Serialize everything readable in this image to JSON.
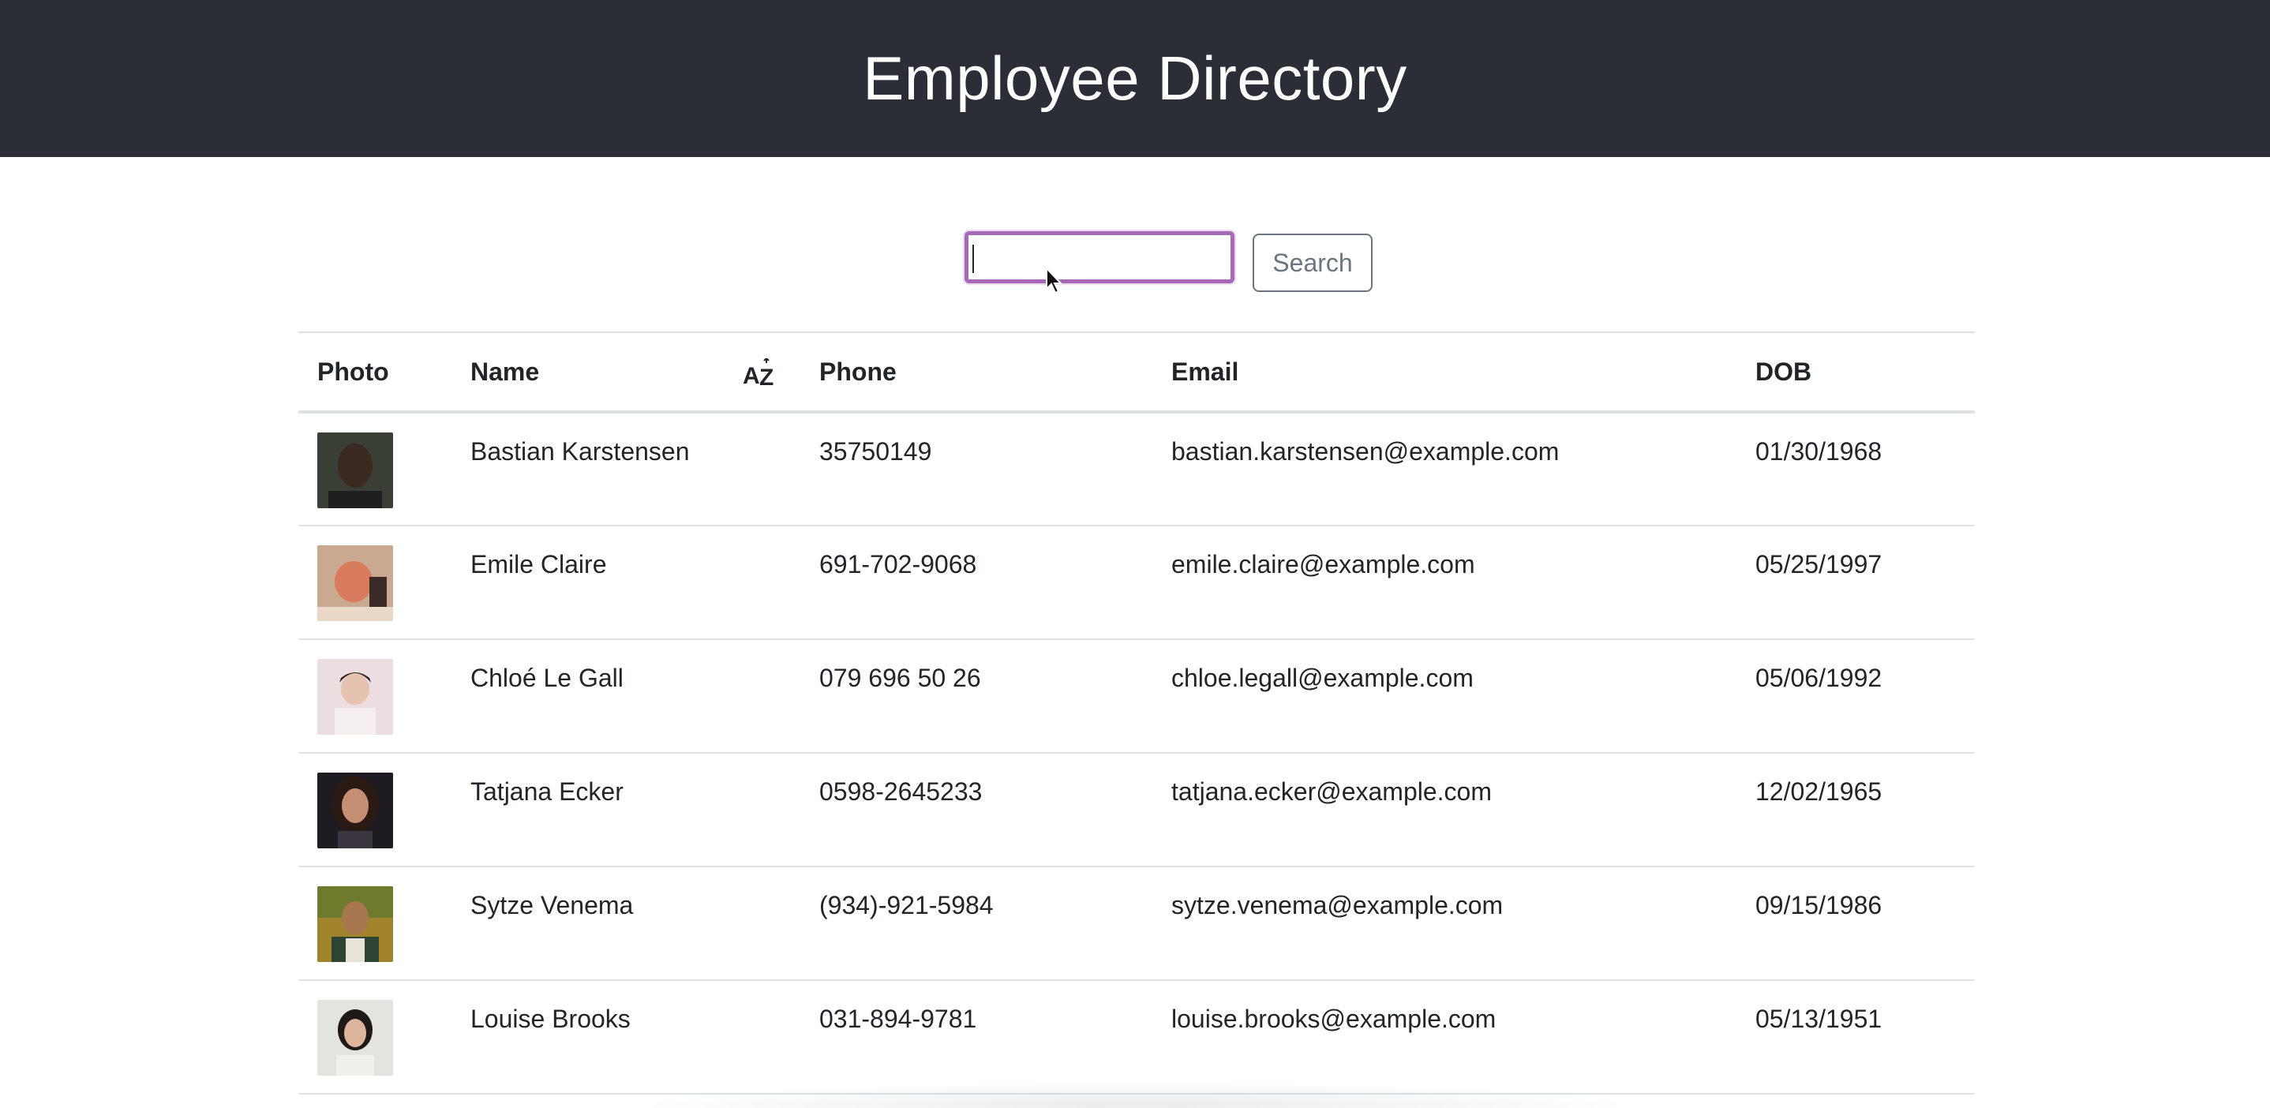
{
  "header": {
    "title": "Employee Directory"
  },
  "search": {
    "value": "",
    "button_label": "Search"
  },
  "table": {
    "columns": [
      "Photo",
      "Name",
      "Phone",
      "Email",
      "DOB"
    ],
    "sort_icon": "sort-alpha-az-icon",
    "rows": [
      {
        "name": "Bastian Karstensen",
        "phone": "35750149",
        "email": "bastian.karstensen@example.com",
        "dob": "01/30/1968"
      },
      {
        "name": "Emile Claire",
        "phone": "691-702-9068",
        "email": "emile.claire@example.com",
        "dob": "05/25/1997"
      },
      {
        "name": "Chloé Le Gall",
        "phone": "079 696 50 26",
        "email": "chloe.legall@example.com",
        "dob": "05/06/1992"
      },
      {
        "name": "Tatjana Ecker",
        "phone": "0598-2645233",
        "email": "tatjana.ecker@example.com",
        "dob": "12/02/1965"
      },
      {
        "name": "Sytze Venema",
        "phone": "(934)-921-5984",
        "email": "sytze.venema@example.com",
        "dob": "09/15/1986"
      },
      {
        "name": "Louise Brooks",
        "phone": "031-894-9781",
        "email": "louise.brooks@example.com",
        "dob": "05/13/1951"
      }
    ]
  },
  "colors": {
    "header_bg": "#2b2e36",
    "focus_ring": "#a868b8",
    "border": "#dee2e6",
    "button_text": "#6c757d"
  }
}
